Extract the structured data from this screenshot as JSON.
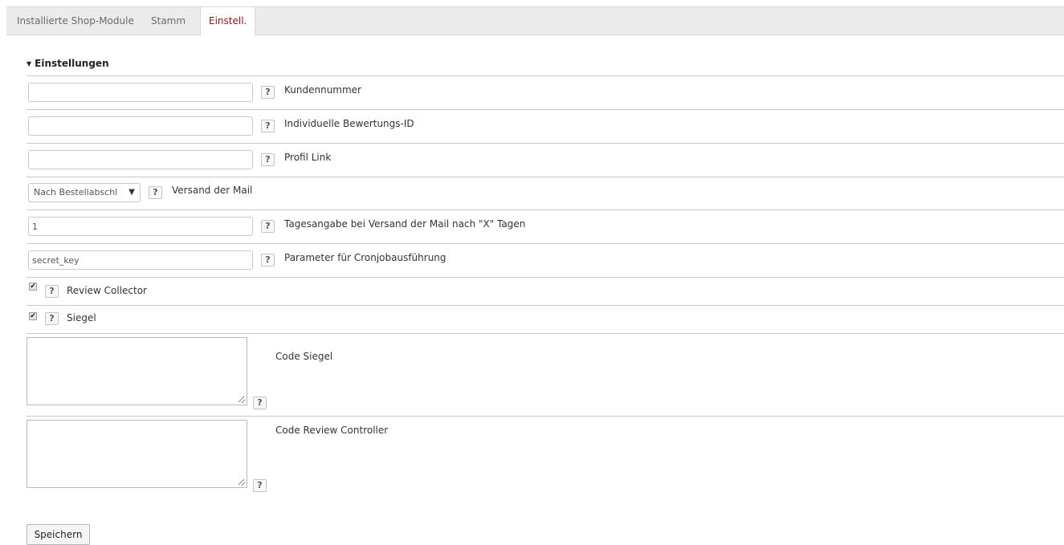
{
  "tabs": [
    {
      "label": "Installierte Shop-Module"
    },
    {
      "label": "Stamm"
    },
    {
      "label": "Einstell."
    }
  ],
  "section": {
    "title": "Einstellungen"
  },
  "help_glyph": "?",
  "fields": {
    "kundennummer": {
      "label": "Kundennummer",
      "value": ""
    },
    "bewertungs_id": {
      "label": "Individuelle Bewertungs-ID",
      "value": ""
    },
    "profil_link": {
      "label": "Profil Link",
      "value": ""
    },
    "versand": {
      "label": "Versand der Mail",
      "selected": "Nach Bestellabschl",
      "arrow": "▼"
    },
    "tagesangabe": {
      "label": "Tagesangabe bei Versand der Mail nach \"X\" Tagen",
      "value": "1"
    },
    "cronjob": {
      "label": "Parameter für Cronjobausführung",
      "value": "secret_key"
    },
    "review_collector": {
      "label": "Review Collector",
      "checked": true
    },
    "siegel": {
      "label": "Siegel",
      "checked": true
    },
    "code_siegel": {
      "label": "Code Siegel",
      "value": ""
    },
    "code_review_controller": {
      "label": "Code Review Controller",
      "value": ""
    }
  },
  "buttons": {
    "save": "Speichern"
  },
  "colors": {
    "active_tab": "#8a1a1a",
    "tabbar_bg": "#ebebeb"
  }
}
